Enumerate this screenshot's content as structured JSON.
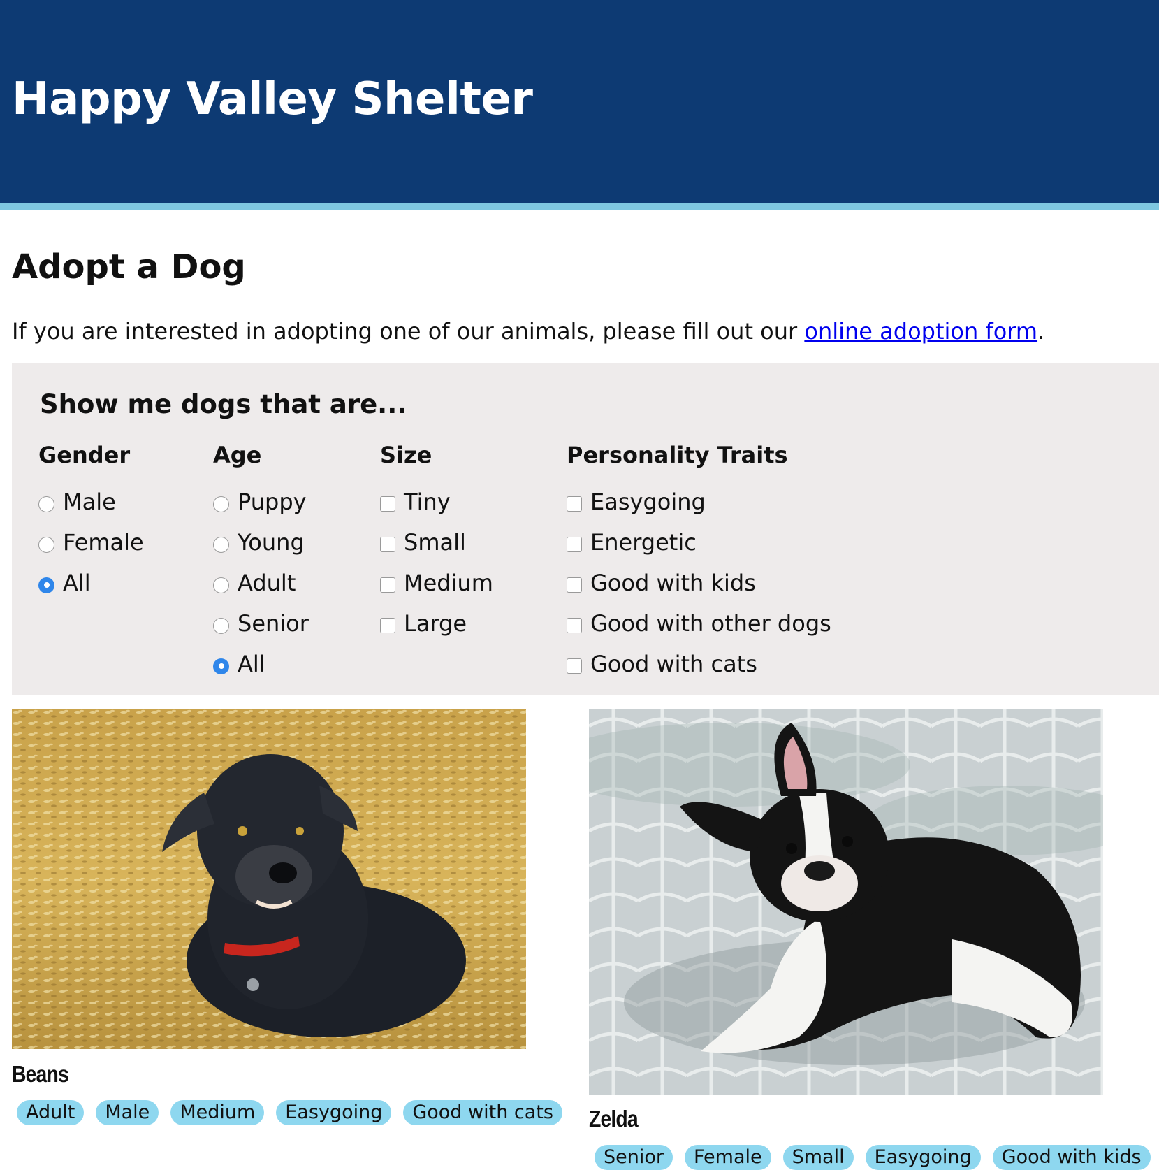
{
  "header": {
    "site_title": "Happy Valley Shelter"
  },
  "page": {
    "title": "Adopt a Dog",
    "intro_before": "If you are interested in adopting one of our animals, please fill out our ",
    "intro_link": "online adoption form",
    "intro_after": "."
  },
  "filters": {
    "heading": "Show me dogs that are...",
    "gender": {
      "title": "Gender",
      "options": [
        "Male",
        "Female",
        "All"
      ],
      "selected": "All"
    },
    "age": {
      "title": "Age",
      "options": [
        "Puppy",
        "Young",
        "Adult",
        "Senior",
        "All"
      ],
      "selected": "All"
    },
    "size": {
      "title": "Size",
      "options": [
        "Tiny",
        "Small",
        "Medium",
        "Large"
      ]
    },
    "traits": {
      "title": "Personality Traits",
      "options": [
        "Easygoing",
        "Energetic",
        "Good with kids",
        "Good with other dogs",
        "Good with cats"
      ]
    }
  },
  "dogs": [
    {
      "name": "Beans",
      "tags": [
        "Adult",
        "Male",
        "Medium",
        "Easygoing",
        "Good with cats"
      ]
    },
    {
      "name": "Zelda",
      "tags": [
        "Senior",
        "Female",
        "Small",
        "Easygoing",
        "Good with kids"
      ]
    }
  ],
  "colors": {
    "header_bg": "#0d3a73",
    "header_border": "#7ec7e0",
    "filter_bg": "#eeebeb",
    "tag_bg": "#8ed7ef",
    "link": "#0000ee",
    "radio_selected": "#2f86ea"
  }
}
